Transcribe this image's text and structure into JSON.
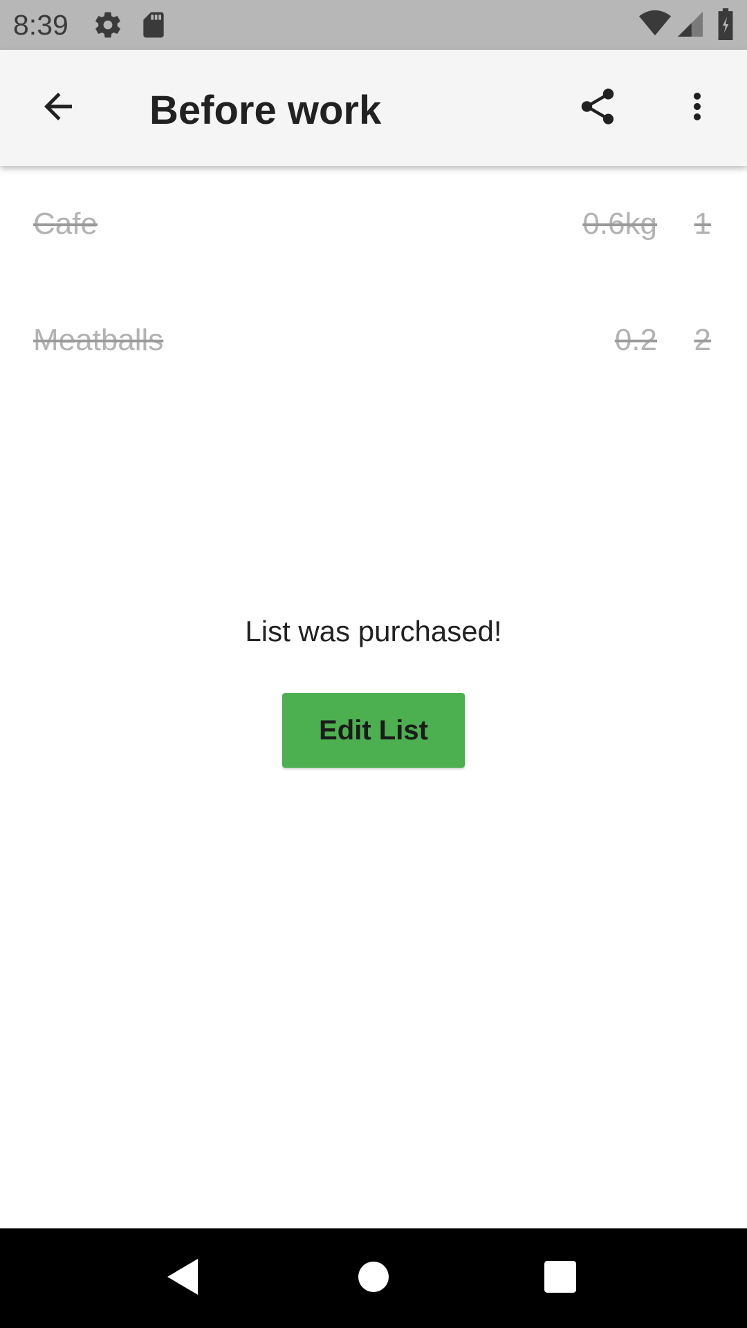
{
  "status_bar": {
    "time": "8:39",
    "icons": [
      "settings-icon",
      "sd-card-icon",
      "wifi-icon",
      "signal-icon",
      "battery-icon"
    ]
  },
  "app_bar": {
    "title": "Before work",
    "icons": [
      "back-arrow-icon",
      "share-icon",
      "more-vert-icon"
    ]
  },
  "items": [
    {
      "name": "Cafe",
      "amount": "0.6kg",
      "quantity": "1"
    },
    {
      "name": "Meatballs",
      "amount": "0.2",
      "quantity": "2"
    }
  ],
  "message": "List was purchased!",
  "edit_button_label": "Edit List",
  "nav_bar": {
    "icons": [
      "nav-back-icon",
      "nav-home-icon",
      "nav-recents-icon"
    ]
  },
  "colors": {
    "status_bar_bg": "#b7b7b7",
    "app_bar_bg": "#f5f5f5",
    "accent_green": "#4caf50",
    "struck_text": "#b3b3b3"
  }
}
